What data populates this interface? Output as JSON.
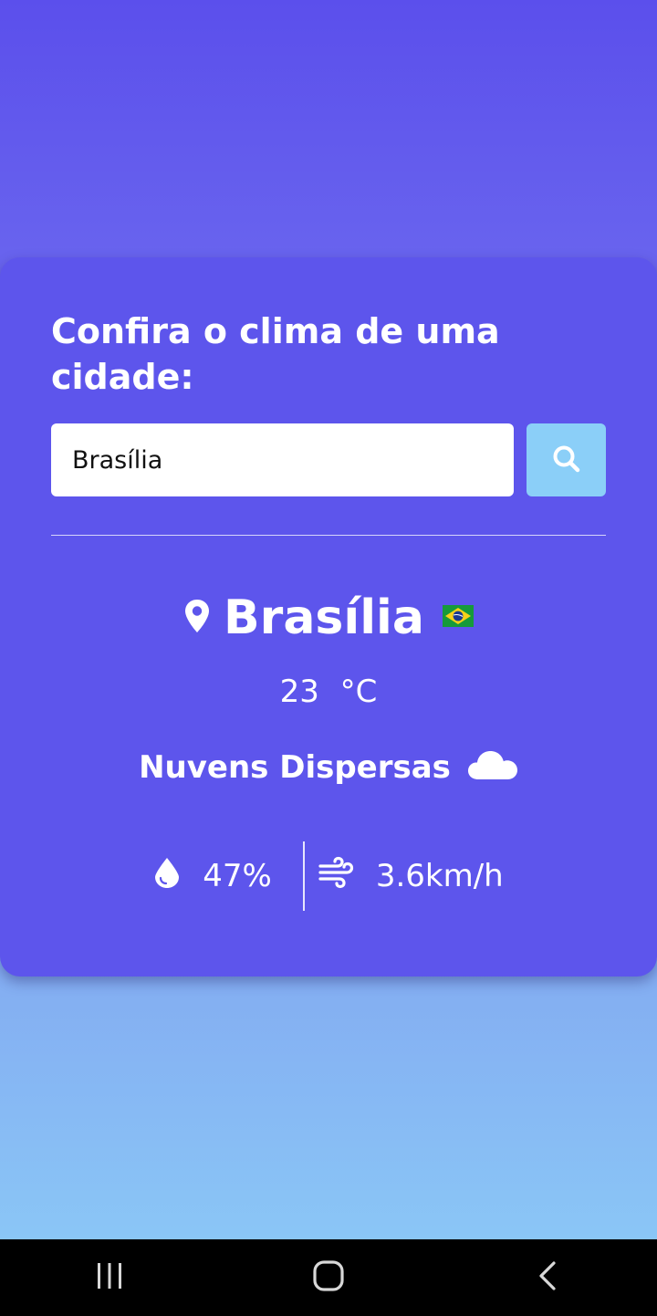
{
  "card": {
    "title": "Confira o clima de uma cidade:",
    "search": {
      "value": "Brasília",
      "placeholder": ""
    }
  },
  "weather": {
    "city": "Brasília",
    "country_flag": "brazil-flag-icon",
    "temperature": "23",
    "unit": "°C",
    "description": "Nuvens Dispersas",
    "condition_icon": "cloud-icon",
    "humidity": "47%",
    "wind": "3.6km/h"
  },
  "colors": {
    "card_bg": "#5d55ec",
    "search_button": "#8bcff8",
    "gradient_top": "#5b4fec",
    "gradient_bottom": "#8ccdf7"
  },
  "navbar": {
    "items": [
      "recent-apps-icon",
      "home-icon",
      "back-icon"
    ]
  }
}
